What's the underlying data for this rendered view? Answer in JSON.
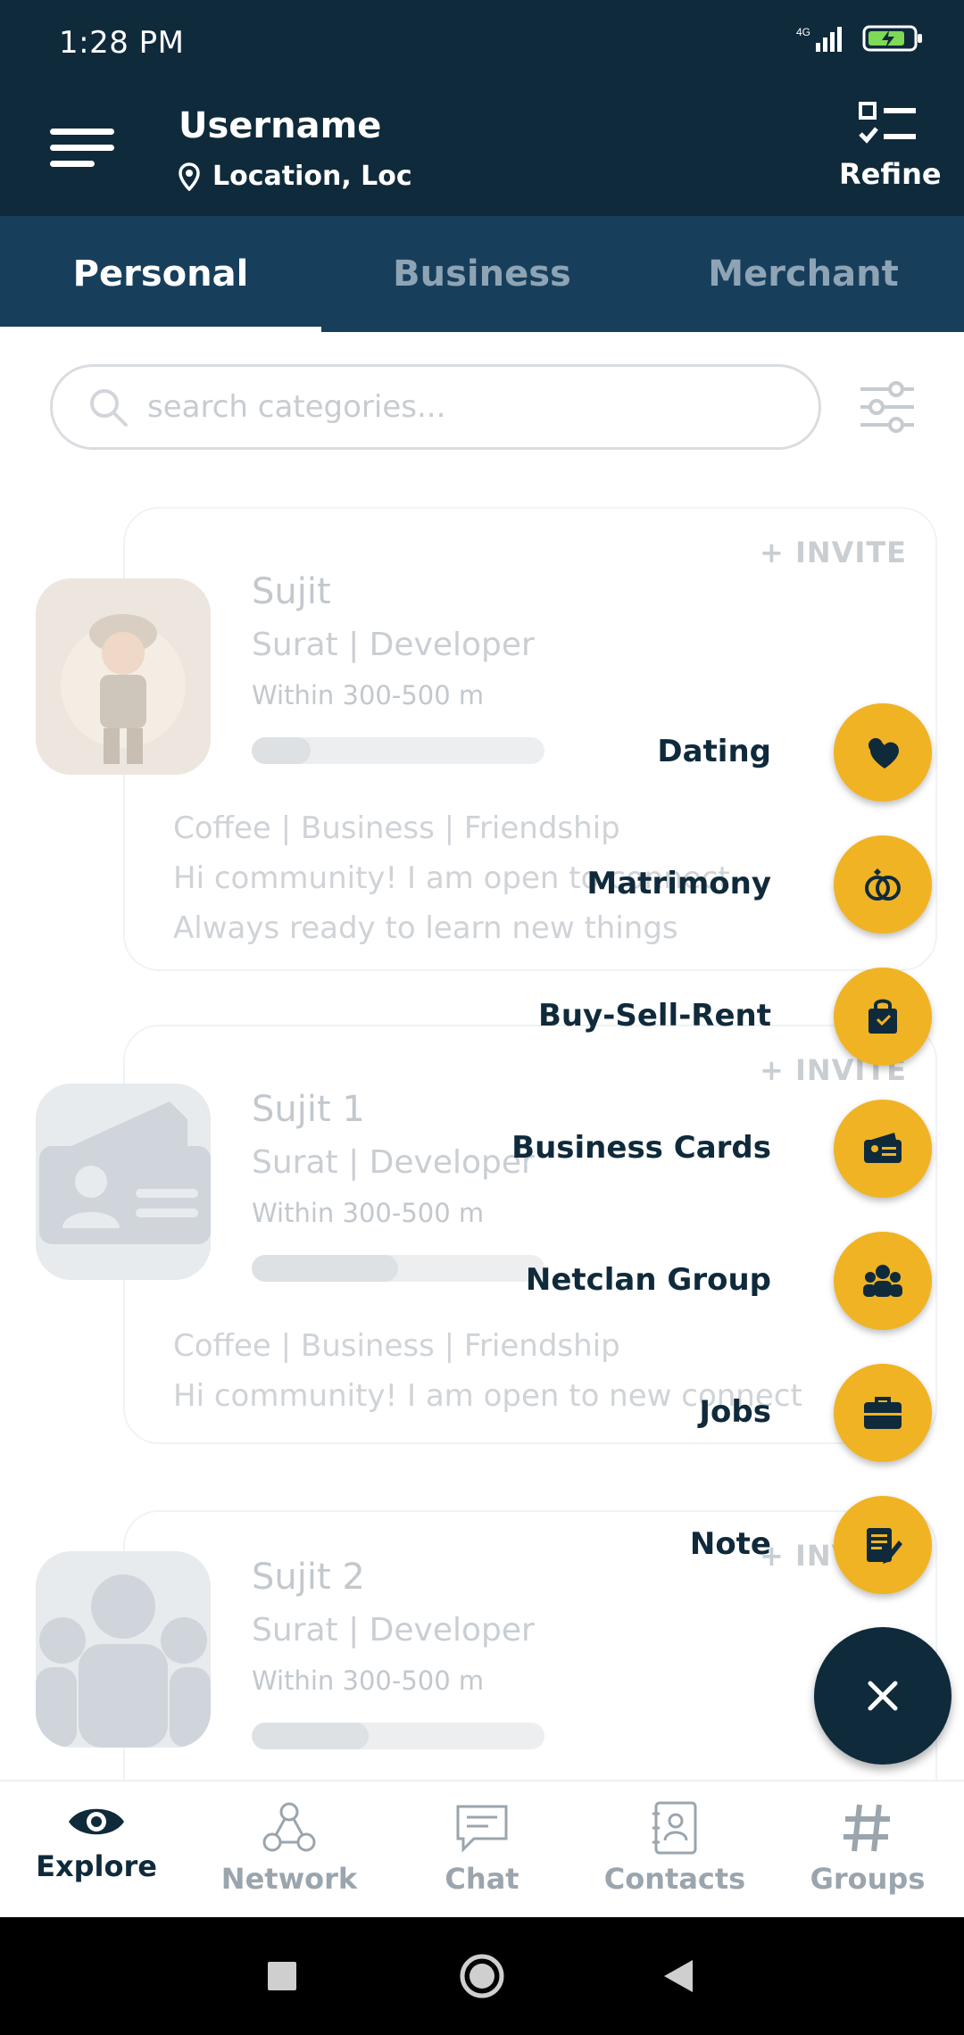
{
  "status": {
    "time": "1:28 PM"
  },
  "header": {
    "username": "Username",
    "location": "Location, Loc",
    "refine_label": "Refine"
  },
  "tabs": [
    {
      "label": "Personal",
      "active": true
    },
    {
      "label": "Business",
      "active": false
    },
    {
      "label": "Merchant",
      "active": false
    }
  ],
  "search": {
    "placeholder": "search categories..."
  },
  "cards": [
    {
      "invite": "+ INVITE",
      "name": "Sujit",
      "sub": "Surat | Developer",
      "distance": "Within 300-500 m",
      "progress": 0.2,
      "lines": [
        "Coffee | Business | Friendship",
        "Hi community! I am open to connect",
        "Always ready to learn new things"
      ]
    },
    {
      "invite": "+ INVITE",
      "name": "Sujit 1",
      "sub": "Surat | Developer",
      "distance": "Within 300-500 m",
      "progress": 0.5,
      "lines": [
        "Coffee | Business | Friendship",
        "Hi community! I am open to new connect"
      ]
    },
    {
      "invite": "+ INVITE",
      "name": "Sujit 2",
      "sub": "Surat | Developer",
      "distance": "Within 300-500 m",
      "progress": 0.4,
      "lines": []
    }
  ],
  "speed_dial": [
    {
      "label": "Dating",
      "icon": "heart-chat-icon"
    },
    {
      "label": "Matrimony",
      "icon": "rings-icon"
    },
    {
      "label": "Buy-Sell-Rent",
      "icon": "shopping-bag-icon"
    },
    {
      "label": "Business Cards",
      "icon": "business-card-icon"
    },
    {
      "label": "Netclan Group",
      "icon": "group-icon"
    },
    {
      "label": "Jobs",
      "icon": "briefcase-icon"
    },
    {
      "label": "Note",
      "icon": "note-icon"
    }
  ],
  "bottom_nav": [
    {
      "label": "Explore",
      "active": true
    },
    {
      "label": "Network",
      "active": false
    },
    {
      "label": "Chat",
      "active": false
    },
    {
      "label": "Contacts",
      "active": false
    },
    {
      "label": "Groups",
      "active": false
    }
  ],
  "colors": {
    "primary": "#0f2a3b",
    "tabbar": "#173f5c",
    "accent": "#f0b323"
  }
}
